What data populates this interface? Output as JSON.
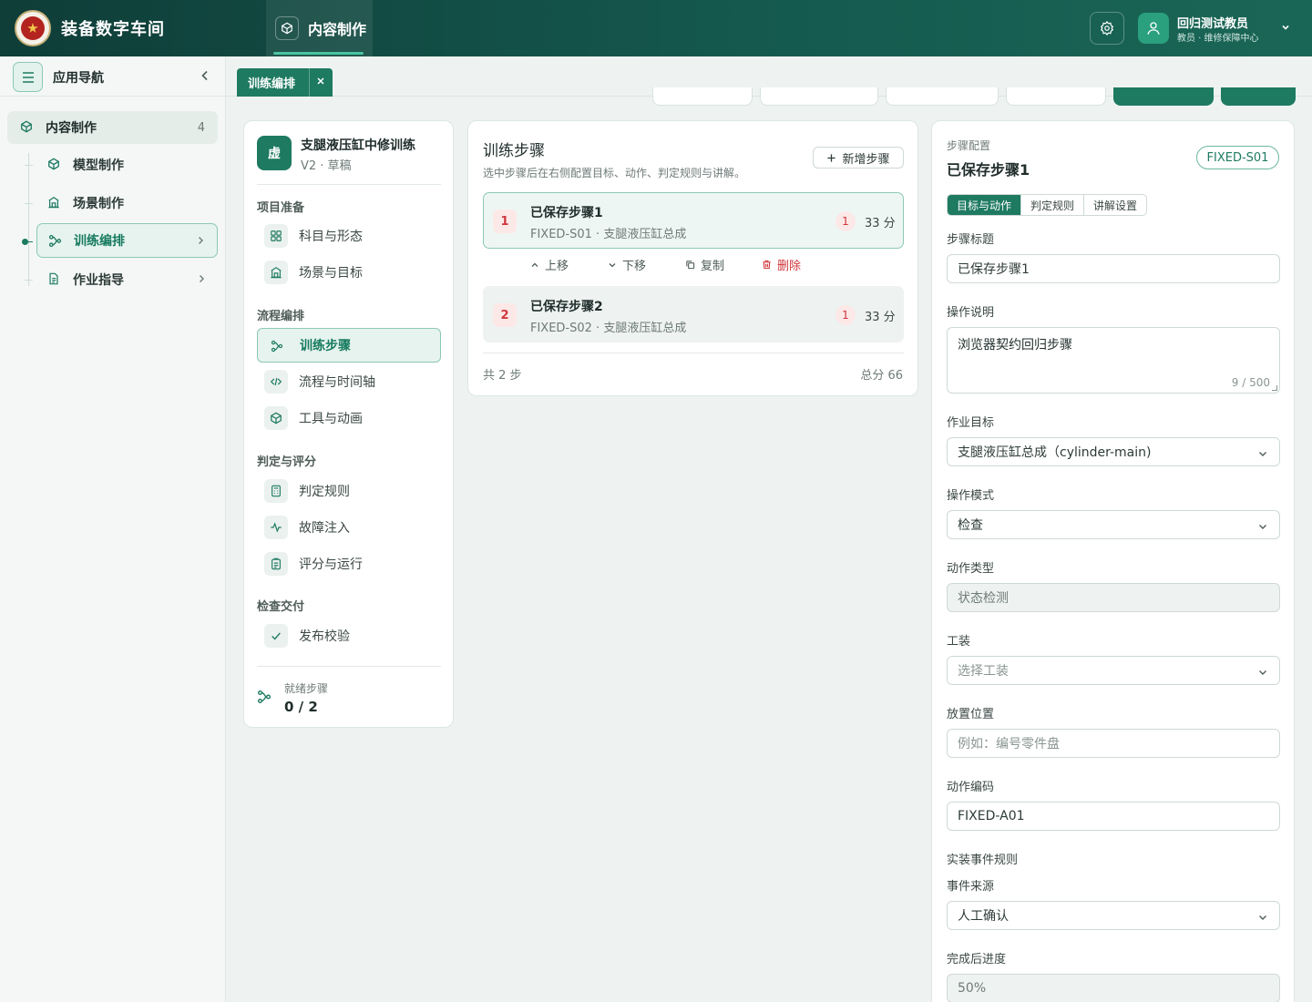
{
  "app": {
    "title": "装备数字车间",
    "top_tab": "内容制作"
  },
  "user": {
    "name": "回归测试教员",
    "role": "教员 · 维修保障中心"
  },
  "nav": {
    "title": "应用导航",
    "root": {
      "label": "内容制作",
      "count": "4"
    },
    "items": [
      {
        "label": "模型制作",
        "icon": "cube-icon"
      },
      {
        "label": "场景制作",
        "icon": "building-icon"
      },
      {
        "label": "训练编排",
        "icon": "flow-icon",
        "active": true
      },
      {
        "label": "作业指导",
        "icon": "document-icon"
      }
    ]
  },
  "content_tab": {
    "label": "训练编排"
  },
  "project": {
    "avatar": "虚",
    "name": "支腿液压缸中修训练",
    "version": "V2 · 草稿",
    "sections": [
      {
        "title": "项目准备",
        "items": [
          "科目与形态",
          "场景与目标"
        ]
      },
      {
        "title": "流程编排",
        "items": [
          "训练步骤",
          "流程与时间轴",
          "工具与动画"
        ]
      },
      {
        "title": "判定与评分",
        "items": [
          "判定规则",
          "故障注入",
          "评分与运行"
        ]
      },
      {
        "title": "检查交付",
        "items": [
          "发布校验"
        ]
      }
    ],
    "ready_label": "就绪步骤",
    "ready_value": "0 / 2"
  },
  "steps_panel": {
    "title": "训练步骤",
    "subtitle": "选中步骤后在右侧配置目标、动作、判定规则与讲解。",
    "add_label": "新增步骤",
    "steps": [
      {
        "num": "1",
        "title": "已保存步骤1",
        "meta": "FIXED-S01 · 支腿液压缸总成",
        "badge": "1",
        "score": "33 分"
      },
      {
        "num": "2",
        "title": "已保存步骤2",
        "meta": "FIXED-S02 · 支腿液压缸总成",
        "badge": "1",
        "score": "33 分"
      }
    ],
    "actions": {
      "up": "上移",
      "down": "下移",
      "copy": "复制",
      "delete": "删除"
    },
    "footer_count": "共 2 步",
    "footer_total": "总分 66"
  },
  "config": {
    "caption": "步骤配置",
    "title": "已保存步骤1",
    "code_badge": "FIXED-S01",
    "tabs": [
      "目标与动作",
      "判定规则",
      "讲解设置"
    ],
    "step_title_label": "步骤标题",
    "step_title_value": "已保存步骤1",
    "desc_label": "操作说明",
    "desc_value": "浏览器契约回归步骤",
    "desc_count": "9 / 500",
    "target_label": "作业目标",
    "target_value": "支腿液压缸总成（cylinder-main)",
    "mode_label": "操作模式",
    "mode_value": "检查",
    "action_type_label": "动作类型",
    "action_type_value": "状态检测",
    "tool_label": "工装",
    "tool_placeholder": "选择工装",
    "place_label": "放置位置",
    "place_placeholder": "例如：编号零件盘",
    "action_code_label": "动作编码",
    "action_code_value": "FIXED-A01",
    "event_rule_label": "实装事件规则",
    "event_source_label": "事件来源",
    "event_source_value": "人工确认",
    "progress_label": "完成后进度",
    "progress_value": "50%"
  },
  "colors": {
    "brand": "#1e7a61",
    "topbar": "#0f3d38",
    "danger": "#d0363c"
  }
}
